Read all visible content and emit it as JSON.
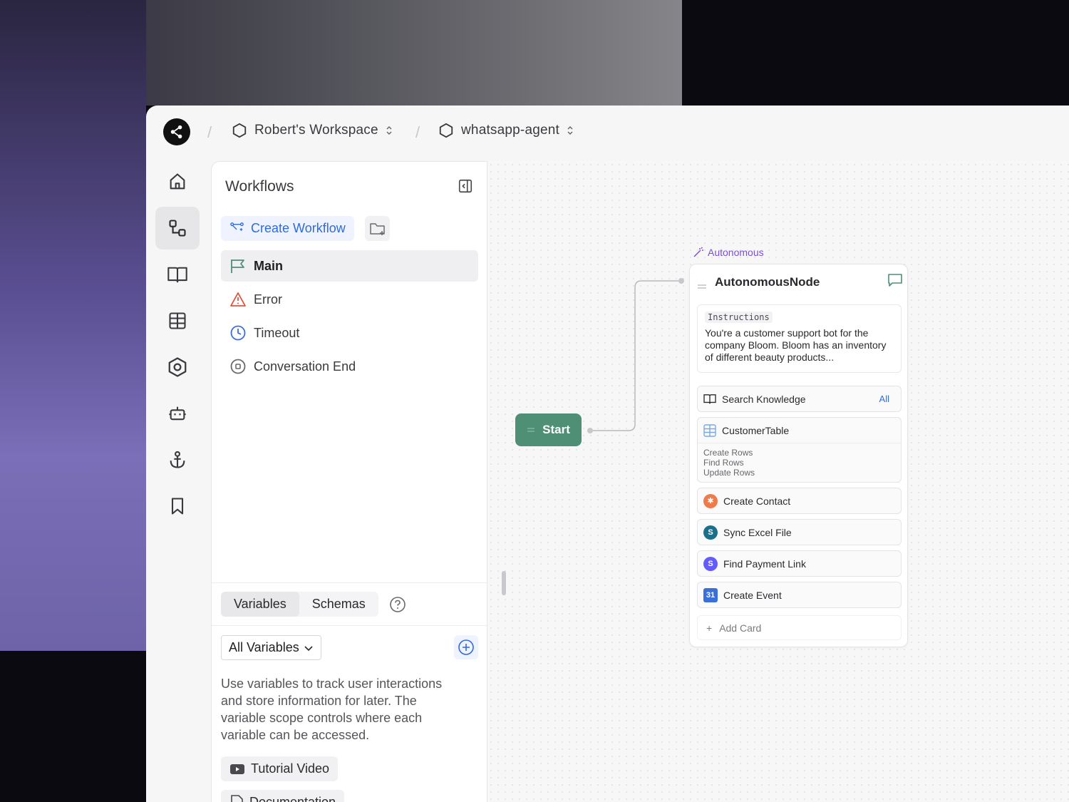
{
  "breadcrumb": {
    "workspace": "Robert's Workspace",
    "project": "whatsapp-agent"
  },
  "rail": {
    "items": [
      "home-icon",
      "workflows-icon",
      "knowledge-icon",
      "tables-icon",
      "settings-icon",
      "agent-icon",
      "integrations-icon",
      "bookmarks-icon"
    ],
    "active": "workflows-icon"
  },
  "workflows": {
    "title": "Workflows",
    "create_label": "Create Workflow",
    "items": [
      {
        "label": "Main",
        "icon": "flag-icon",
        "active": true
      },
      {
        "label": "Error",
        "icon": "warning-icon",
        "color": "#e0533a"
      },
      {
        "label": "Timeout",
        "icon": "clock-icon",
        "color": "#3b6fd8"
      },
      {
        "label": "Conversation End",
        "icon": "stop-icon"
      }
    ]
  },
  "variables": {
    "tabs": [
      "Variables",
      "Schemas"
    ],
    "active_tab": "Variables",
    "filter": "All Variables",
    "description": "Use variables to track user interactions and store information for later. The variable scope controls where each variable can be accessed.",
    "tutorial_label": "Tutorial Video",
    "docs_label": "Documentation"
  },
  "canvas": {
    "start_label": "Start",
    "start_color": "#4f8f76",
    "node_type_label": "Autonomous",
    "node_title": "AutonomousNode",
    "instructions_tag": "Instructions",
    "instructions_text": "You're a customer support bot for the company Bloom. Bloom has an inventory of different beauty products...",
    "cards": [
      {
        "label": "Search Knowledge",
        "badge": "All",
        "icon": "book-icon"
      },
      {
        "label": "CustomerTable",
        "icon": "table-icon",
        "actions": [
          "Create Rows",
          "Find Rows",
          "Update Rows"
        ]
      },
      {
        "label": "Create Contact",
        "icon": "hubspot-icon",
        "color": "#ef7a4a"
      },
      {
        "label": "Sync Excel File",
        "icon": "sharepoint-icon",
        "color": "#1b6f8a"
      },
      {
        "label": "Find Payment Link",
        "icon": "stripe-icon",
        "color": "#635bff"
      },
      {
        "label": "Create Event",
        "icon": "calendar-icon",
        "color": "#3b6fd8"
      }
    ],
    "add_card_label": "Add Card"
  }
}
